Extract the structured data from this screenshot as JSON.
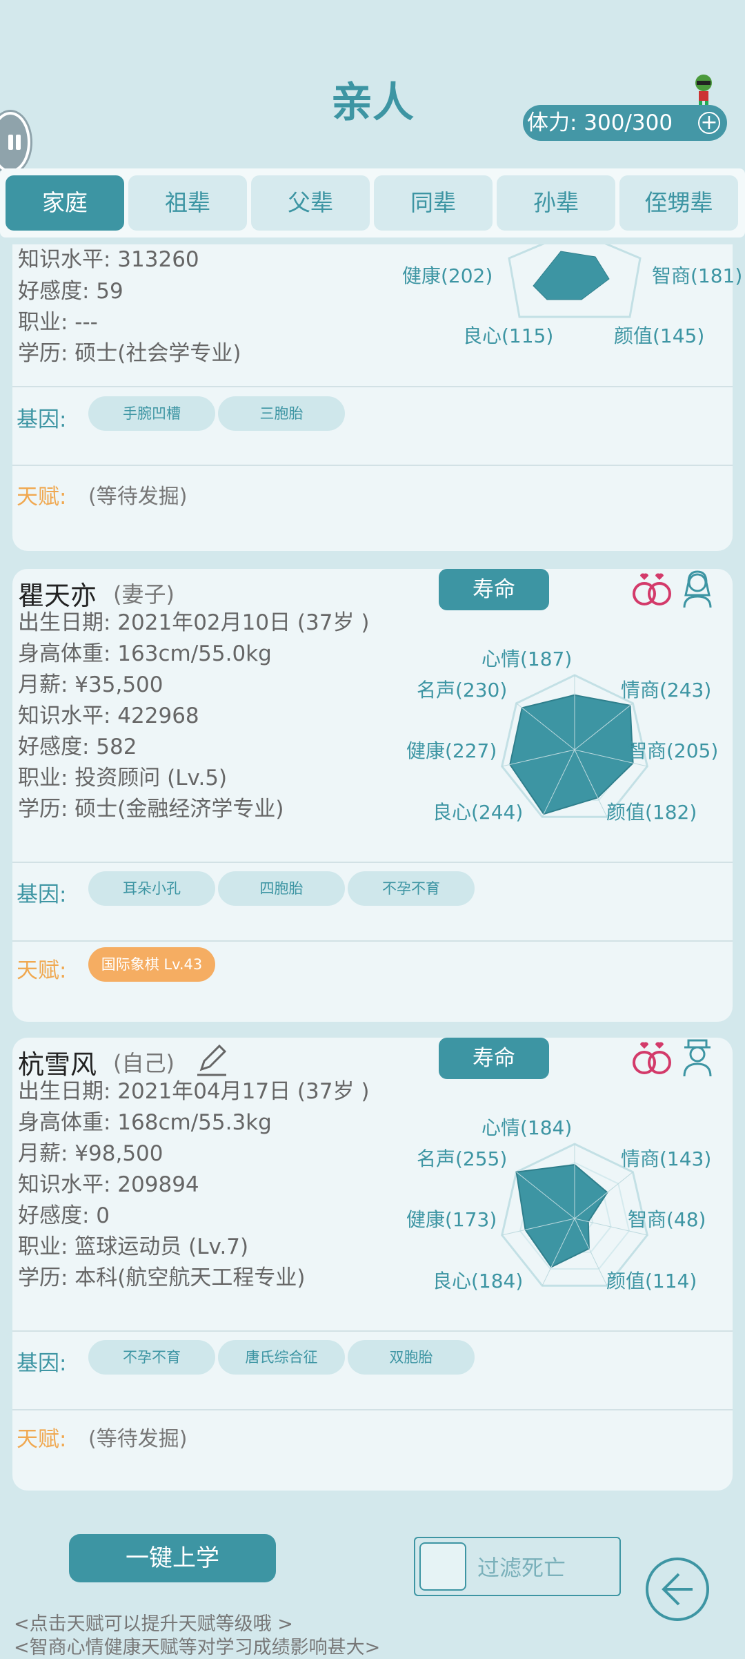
{
  "header": {
    "title": "亲人",
    "stamina": "体力: 300/300",
    "plus": "+"
  },
  "tabs": [
    "家庭",
    "祖辈",
    "父辈",
    "同辈",
    "孙辈",
    "侄甥辈"
  ],
  "card1": {
    "info": [
      "知识水平: 313260",
      "好感度: 59",
      "职业: ---",
      "学历: 硕士(社会学专业)"
    ],
    "genes_label": "基因:",
    "genes": [
      "手腕凹槽",
      "三胞胎"
    ],
    "talent_label": "天赋:",
    "talent_pending": "(等待发掘)",
    "radar_labels": [
      "健康(202)",
      "智商(181)",
      "良心(115)",
      "颜值(145)"
    ]
  },
  "card2": {
    "name": "瞿天亦",
    "relation": "(妻子)",
    "life_button": "寿命",
    "info": [
      "出生日期: 2021年02月10日 (37岁 )",
      "身高体重: 163cm/55.0kg",
      "月薪: ¥35,500",
      "知识水平: 422968",
      "好感度: 582",
      "职业: 投资顾问 (Lv.5)",
      "学历: 硕士(金融经济学专业)"
    ],
    "genes_label": "基因:",
    "genes": [
      "耳朵小孔",
      "四胞胎",
      "不孕不育"
    ],
    "talent_label": "天赋:",
    "talent": "国际象棋 Lv.43",
    "radar_labels": [
      "心情(187)",
      "情商(243)",
      "智商(205)",
      "颜值(182)",
      "良心(244)",
      "健康(227)",
      "名声(230)"
    ],
    "stats": [
      187,
      243,
      205,
      182,
      244,
      227,
      230
    ]
  },
  "card3": {
    "name": "杭雪风",
    "relation": "(自己)",
    "life_button": "寿命",
    "info": [
      "出生日期: 2021年04月17日 (37岁 )",
      "身高体重: 168cm/55.3kg",
      "月薪: ¥98,500",
      "知识水平: 209894",
      "好感度: 0",
      "职业: 篮球运动员 (Lv.7)",
      "学历: 本科(航空航天工程专业)"
    ],
    "genes_label": "基因:",
    "genes": [
      "不孕不育",
      "唐氏综合征",
      "双胞胎"
    ],
    "talent_label": "天赋:",
    "talent_pending": "(等待发掘)",
    "radar_labels": [
      "心情(184)",
      "情商(143)",
      "智商(48)",
      "颜值(114)",
      "良心(184)",
      "健康(173)",
      "名声(255)"
    ],
    "stats": [
      184,
      143,
      48,
      114,
      184,
      173,
      255
    ]
  },
  "footer": {
    "school_button": "一键上学",
    "filter_label": "过滤死亡",
    "tip1": "<点击天赋可以提升天赋等级哦 >",
    "tip2": "<智商心情健康天赋等对学习成绩影响甚大>"
  },
  "colors": {
    "accent": "#3d95a3",
    "talent": "#f0a850",
    "background": "#d3e8ec"
  }
}
